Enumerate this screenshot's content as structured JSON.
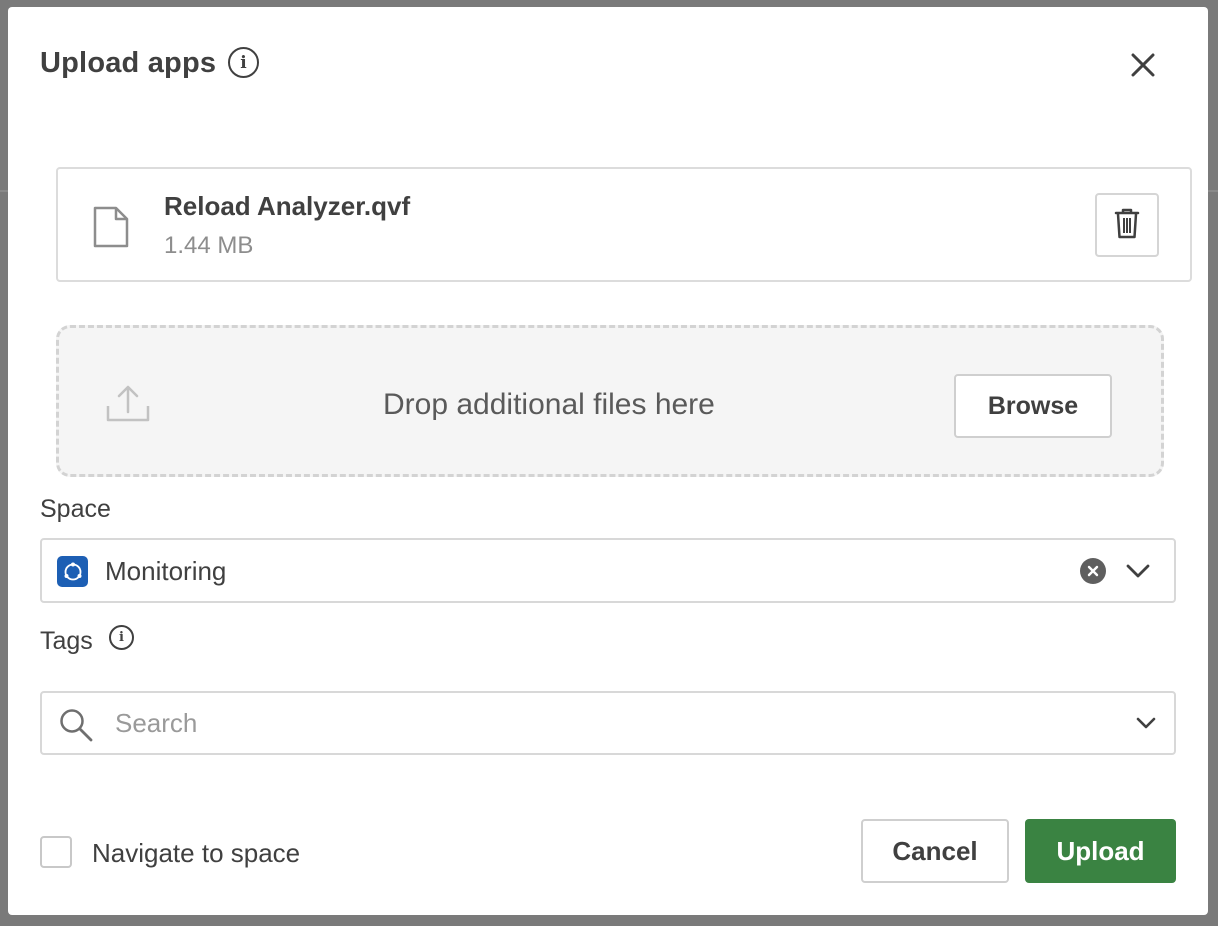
{
  "dialog": {
    "title": "Upload apps",
    "info_icon": "info-icon",
    "close_icon": "close-icon"
  },
  "file": {
    "name": "Reload Analyzer.qvf",
    "size": "1.44 MB",
    "icon": "document-icon",
    "delete_icon": "trash-icon"
  },
  "dropzone": {
    "text": "Drop additional files here",
    "icon": "upload-icon",
    "browse_label": "Browse"
  },
  "space": {
    "label": "Space",
    "value": "Monitoring",
    "badge_icon": "space-icon",
    "badge_color": "#1d5fb4",
    "clear_icon": "clear-icon",
    "chevron_icon": "chevron-down-icon"
  },
  "tags": {
    "label": "Tags",
    "info_icon": "info-icon",
    "placeholder": "Search",
    "search_icon": "search-icon",
    "chevron_icon": "chevron-down-icon"
  },
  "footer": {
    "navigate_label": "Navigate to space",
    "navigate_checked": false,
    "cancel_label": "Cancel",
    "upload_label": "Upload",
    "upload_color": "#3a8342"
  }
}
